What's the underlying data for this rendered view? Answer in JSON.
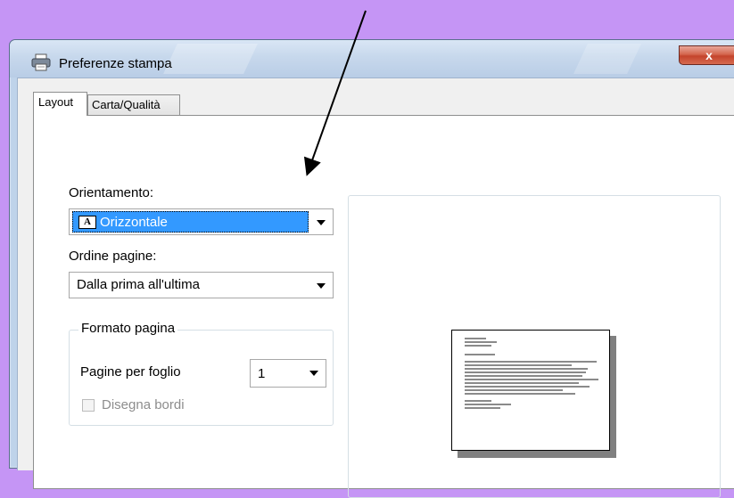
{
  "window": {
    "title": "Preferenze stampa",
    "close_label": "x"
  },
  "tabs": [
    {
      "label": "Layout",
      "selected": true
    },
    {
      "label": "Carta/Qualità",
      "selected": false
    }
  ],
  "orientation": {
    "label": "Orientamento:",
    "value": "Orizzontale",
    "icon_letter": "A"
  },
  "page_order": {
    "label": "Ordine pagine:",
    "value": "Dalla prima all'ultima"
  },
  "page_format": {
    "legend": "Formato pagina",
    "pages_per_sheet_label": "Pagine per foglio",
    "pages_per_sheet_value": "1",
    "draw_borders_label": "Disegna bordi",
    "draw_borders_checked": false,
    "draw_borders_enabled": false
  },
  "colors": {
    "background": "#c595f5",
    "selection": "#3399ff",
    "close_button": "#c4442c"
  }
}
